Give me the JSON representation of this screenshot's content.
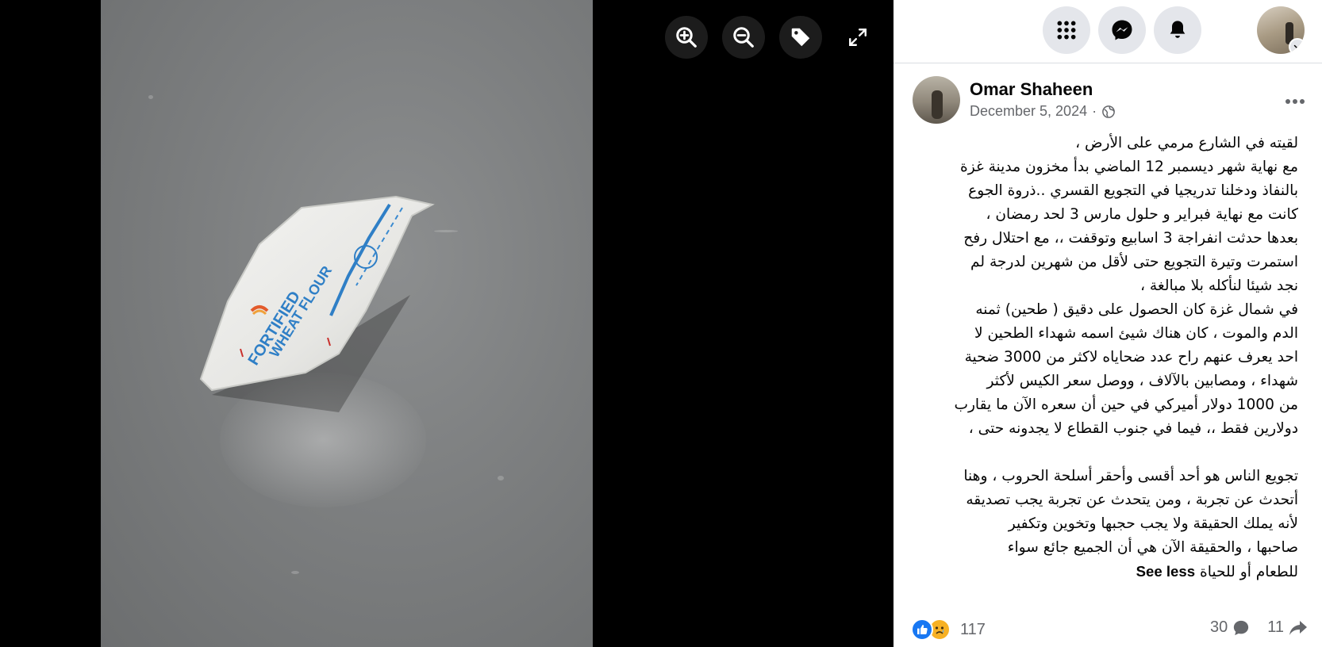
{
  "viewer": {
    "tools": [
      {
        "name": "zoom-in",
        "icon": "zoom-in-icon"
      },
      {
        "name": "zoom-out",
        "icon": "zoom-out-icon"
      },
      {
        "name": "tag",
        "icon": "tag-icon"
      },
      {
        "name": "fullscreen",
        "icon": "expand-icon"
      }
    ],
    "photo_bag_text": {
      "line1": "FORTIFIED",
      "line2": "WHEAT FLOUR"
    }
  },
  "topnav": {
    "icons": [
      "menu-grid-icon",
      "messenger-icon",
      "bell-icon",
      "profile-avatar"
    ]
  },
  "post": {
    "author": "Omar Shaheen",
    "date": "December 5, 2024",
    "separator": "·",
    "privacy_icon": "globe-icon",
    "body_lines": [
      "لقيته في الشارع مرمي على الأرض ،",
      "مع نهاية شهر ديسمبر 12 الماضي بدأ مخزون مدينة غزة",
      "بالنفاذ ودخلنا تدريجيا في التجويع القسري ..ذروة الجوع",
      "كانت مع نهاية فبراير و حلول مارس 3 لحد رمضان ،",
      "بعدها حدثت انفراجة 3 اسابيع وتوقفت ،، مع احتلال رفح",
      "استمرت وتيرة التجويع حتى لأقل من شهرين لدرجة لم",
      "نجد شيئا لنأكله بلا مبالغة ،",
      "في شمال غزة كان الحصول على دقيق ( طحين) ثمنه",
      "الدم والموت ، كان هناك شيئ اسمه شهداء الطحين لا",
      "احد يعرف عنهم راح عدد ضحاياه لاكثر من 3000 ضحية",
      "شهداء ، ومصابين بالآلاف ، ووصل سعر الكيس لأكثر",
      "من 1000 دولار أميركي في حين أن سعره الآن ما يقارب",
      "دولارين فقط ،، فيما في جنوب القطاع لا يجدونه حتى ،"
    ],
    "body_lines_2": [
      "تجويع الناس هو أحد أقسى وأحقر أسلحة الحروب ، وهنا",
      "أتحدث عن تجربة ، ومن يتحدث عن تجربة يجب تصديقه",
      "لأنه يملك الحقيقة ولا يجب حجبها وتخوين وتكفير",
      "صاحبها ، والحقيقة الآن هي أن الجميع جائع سواء"
    ],
    "last_line": "للطعام أو للحياة",
    "see_less": "See less",
    "reactions": {
      "types": [
        "like",
        "sad"
      ],
      "count": "117"
    },
    "comments": "30",
    "shares": "11"
  },
  "colors": {
    "facebook_blue": "#1877f2",
    "sad_yellow": "#f7b125",
    "secondary_text": "#65676b"
  }
}
